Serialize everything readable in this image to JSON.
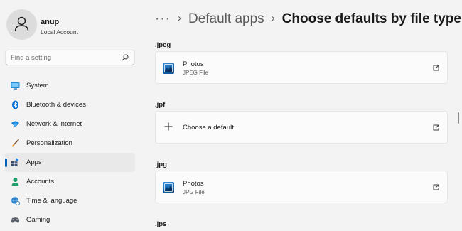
{
  "profile": {
    "name": "anup",
    "subtitle": "Local Account"
  },
  "search": {
    "placeholder": "Find a setting"
  },
  "nav": {
    "items": [
      {
        "label": "System",
        "icon": "system-icon"
      },
      {
        "label": "Bluetooth & devices",
        "icon": "bluetooth-icon"
      },
      {
        "label": "Network & internet",
        "icon": "wifi-icon"
      },
      {
        "label": "Personalization",
        "icon": "brush-icon"
      },
      {
        "label": "Apps",
        "icon": "apps-icon",
        "active": true
      },
      {
        "label": "Accounts",
        "icon": "person-icon"
      },
      {
        "label": "Time & language",
        "icon": "globe-clock-icon"
      },
      {
        "label": "Gaming",
        "icon": "gamepad-icon"
      }
    ]
  },
  "breadcrumb": {
    "more": "···",
    "separator": "›",
    "parent": "Default apps",
    "current": "Choose defaults by file type"
  },
  "sections": [
    {
      "ext": ".jpeg",
      "app": "Photos",
      "type": "JPEG File"
    },
    {
      "ext": ".jpf",
      "choose_label": "Choose a default"
    },
    {
      "ext": ".jpg",
      "app": "Photos",
      "type": "JPG File"
    },
    {
      "ext": ".jps"
    }
  ],
  "colors": {
    "accent": "#005fb8",
    "background": "#f3f3f3",
    "card": "#fbfbfb"
  }
}
